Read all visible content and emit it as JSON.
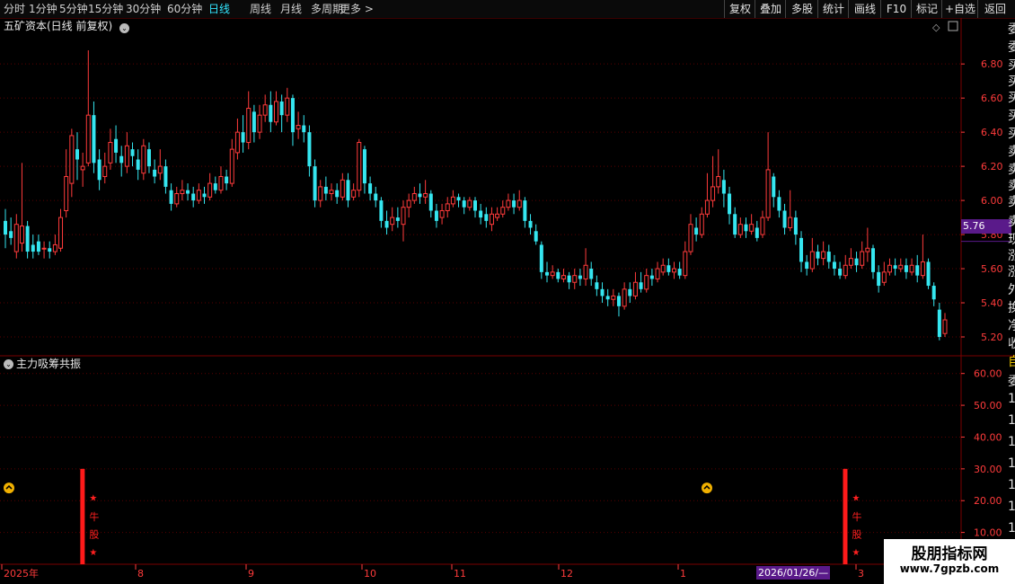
{
  "toolbar": {
    "periods": [
      "分时",
      "1分钟",
      "5分钟",
      "15分钟",
      "30分钟",
      "60分钟",
      "日线",
      "周线",
      "月线",
      "多周期",
      "更多 >"
    ],
    "active": "日线",
    "right": [
      "复权",
      "叠加",
      "多股",
      "统计",
      "画线",
      "F10",
      "标记",
      "+自选",
      "返回"
    ]
  },
  "main_chart": {
    "title": "五矿资本(日线 前复权)",
    "last_price": "5.76"
  },
  "sub_chart": {
    "title": "主力吸筹共振",
    "signal_text": "牛股"
  },
  "x_axis": {
    "labels": [
      "2025年",
      "8",
      "9",
      "10",
      "11",
      "12",
      "1",
      "3"
    ],
    "highlight": "2026/01/26/—"
  },
  "right_panel_chars": [
    "委",
    "委",
    "买",
    "买",
    "买",
    "买",
    "买",
    "卖",
    "卖",
    "卖",
    "卖",
    "卖",
    "现",
    "涨",
    "涨",
    "外",
    "换",
    "净",
    "收",
    "自",
    "委",
    "1",
    "1",
    "1",
    "1",
    "1",
    "1",
    "1",
    "1",
    "1"
  ],
  "watermark": {
    "line1": "股朋指标网",
    "line2": "www.7gpzb.com"
  },
  "colors": {
    "up": "#ff3b3b",
    "down": "#35e6f0",
    "axis": "#ff3b3b",
    "active_tab": "#33e6ff",
    "tag": "#5a1a8a"
  },
  "chart_data": [
    {
      "type": "candlestick",
      "title": "五矿资本(日线 前复权)",
      "ylim": [
        5.1,
        6.98
      ],
      "y_ticks": [
        6.8,
        6.6,
        6.4,
        6.2,
        6.0,
        5.8,
        5.6,
        5.4,
        5.2
      ],
      "y_tick_labels": [
        "6.80",
        "6.60",
        "6.40",
        "6.20",
        "6.00",
        "5.80",
        "5.60",
        "5.40",
        "5.20"
      ],
      "last_price": 5.76,
      "candles": [
        [
          5.88,
          5.8,
          5.95,
          5.72
        ],
        [
          5.82,
          5.78,
          5.9,
          5.74
        ],
        [
          5.7,
          5.86,
          5.92,
          5.66
        ],
        [
          5.75,
          5.85,
          6.22,
          5.7
        ],
        [
          5.85,
          5.7,
          5.88,
          5.66
        ],
        [
          5.74,
          5.7,
          5.8,
          5.66
        ],
        [
          5.76,
          5.7,
          5.8,
          5.68
        ],
        [
          5.72,
          5.72,
          5.76,
          5.66
        ],
        [
          5.72,
          5.7,
          5.76,
          5.66
        ],
        [
          5.7,
          5.74,
          5.8,
          5.68
        ],
        [
          5.72,
          5.9,
          5.95,
          5.7
        ],
        [
          5.94,
          6.14,
          6.3,
          5.9
        ],
        [
          6.1,
          6.38,
          6.42,
          6.02
        ],
        [
          6.3,
          6.24,
          6.4,
          6.12
        ],
        [
          6.18,
          6.2,
          6.28,
          6.08
        ],
        [
          6.22,
          6.5,
          6.88,
          6.2
        ],
        [
          6.5,
          6.22,
          6.58,
          6.16
        ],
        [
          6.24,
          6.12,
          6.3,
          6.06
        ],
        [
          6.14,
          6.2,
          6.28,
          6.1
        ],
        [
          6.22,
          6.34,
          6.42,
          6.18
        ],
        [
          6.36,
          6.28,
          6.44,
          6.22
        ],
        [
          6.26,
          6.22,
          6.32,
          6.14
        ],
        [
          6.2,
          6.32,
          6.4,
          6.16
        ],
        [
          6.3,
          6.26,
          6.34,
          6.2
        ],
        [
          6.24,
          6.18,
          6.3,
          6.12
        ],
        [
          6.16,
          6.32,
          6.36,
          6.12
        ],
        [
          6.3,
          6.2,
          6.34,
          6.16
        ],
        [
          6.18,
          6.14,
          6.24,
          6.1
        ],
        [
          6.16,
          6.2,
          6.3,
          6.12
        ],
        [
          6.2,
          6.08,
          6.24,
          6.04
        ],
        [
          6.06,
          5.98,
          6.1,
          5.94
        ],
        [
          5.98,
          6.04,
          6.08,
          5.96
        ],
        [
          6.04,
          6.06,
          6.12,
          6.0
        ],
        [
          6.06,
          6.04,
          6.1,
          6.0
        ],
        [
          6.04,
          6.0,
          6.08,
          5.96
        ],
        [
          6.0,
          6.06,
          6.1,
          5.98
        ],
        [
          6.04,
          6.02,
          6.08,
          5.98
        ],
        [
          6.02,
          6.1,
          6.16,
          6.0
        ],
        [
          6.1,
          6.06,
          6.14,
          6.04
        ],
        [
          6.06,
          6.14,
          6.2,
          6.04
        ],
        [
          6.14,
          6.1,
          6.18,
          6.06
        ],
        [
          6.1,
          6.3,
          6.36,
          6.08
        ],
        [
          6.28,
          6.4,
          6.48,
          6.24
        ],
        [
          6.4,
          6.34,
          6.5,
          6.28
        ],
        [
          6.34,
          6.54,
          6.64,
          6.3
        ],
        [
          6.52,
          6.4,
          6.56,
          6.34
        ],
        [
          6.4,
          6.5,
          6.56,
          6.36
        ],
        [
          6.5,
          6.56,
          6.62,
          6.46
        ],
        [
          6.56,
          6.46,
          6.64,
          6.4
        ],
        [
          6.46,
          6.58,
          6.64,
          6.44
        ],
        [
          6.58,
          6.5,
          6.62,
          6.4
        ],
        [
          6.5,
          6.6,
          6.66,
          6.46
        ],
        [
          6.6,
          6.4,
          6.62,
          6.32
        ],
        [
          6.42,
          6.44,
          6.52,
          6.36
        ],
        [
          6.44,
          6.4,
          6.5,
          6.34
        ],
        [
          6.4,
          6.2,
          6.44,
          6.14
        ],
        [
          6.2,
          6.0,
          6.24,
          5.96
        ],
        [
          6.0,
          6.08,
          6.12,
          5.96
        ],
        [
          6.08,
          6.04,
          6.14,
          6.0
        ],
        [
          6.04,
          6.06,
          6.1,
          6.0
        ],
        [
          6.06,
          6.02,
          6.1,
          5.98
        ],
        [
          6.02,
          6.12,
          6.16,
          6.0
        ],
        [
          6.12,
          6.0,
          6.16,
          5.96
        ],
        [
          6.02,
          6.06,
          6.1,
          6.0
        ],
        [
          6.06,
          6.34,
          6.36,
          6.02
        ],
        [
          6.3,
          6.1,
          6.32,
          6.04
        ],
        [
          6.1,
          6.04,
          6.14,
          6.0
        ],
        [
          6.04,
          6.0,
          6.08,
          5.96
        ],
        [
          6.0,
          5.88,
          6.02,
          5.84
        ],
        [
          5.88,
          5.84,
          5.94,
          5.8
        ],
        [
          5.86,
          5.9,
          5.96,
          5.82
        ],
        [
          5.9,
          5.88,
          5.96,
          5.84
        ],
        [
          5.86,
          5.96,
          6.0,
          5.76
        ],
        [
          5.96,
          6.0,
          6.04,
          5.9
        ],
        [
          6.0,
          6.04,
          6.08,
          5.98
        ],
        [
          6.04,
          6.02,
          6.1,
          5.98
        ],
        [
          6.02,
          6.04,
          6.12,
          5.98
        ],
        [
          6.04,
          5.94,
          6.06,
          5.9
        ],
        [
          5.94,
          5.88,
          5.98,
          5.84
        ],
        [
          5.9,
          5.94,
          5.98,
          5.86
        ],
        [
          5.94,
          5.98,
          6.02,
          5.9
        ],
        [
          5.98,
          6.02,
          6.06,
          5.96
        ],
        [
          6.02,
          6.0,
          6.04,
          5.96
        ],
        [
          6.0,
          5.96,
          6.02,
          5.92
        ],
        [
          5.96,
          6.0,
          6.02,
          5.94
        ],
        [
          6.0,
          5.94,
          6.02,
          5.9
        ],
        [
          5.94,
          5.9,
          5.98,
          5.86
        ],
        [
          5.92,
          5.88,
          5.96,
          5.84
        ],
        [
          5.86,
          5.92,
          5.96,
          5.82
        ],
        [
          5.9,
          5.92,
          5.96,
          5.88
        ],
        [
          5.92,
          5.96,
          6.0,
          5.9
        ],
        [
          5.96,
          6.0,
          6.04,
          5.94
        ],
        [
          6.0,
          5.96,
          6.04,
          5.92
        ],
        [
          5.96,
          6.0,
          6.06,
          5.94
        ],
        [
          6.0,
          5.88,
          6.02,
          5.84
        ],
        [
          5.88,
          5.84,
          5.92,
          5.8
        ],
        [
          5.82,
          5.76,
          5.86,
          5.74
        ],
        [
          5.74,
          5.58,
          5.76,
          5.54
        ],
        [
          5.58,
          5.56,
          5.64,
          5.52
        ],
        [
          5.56,
          5.58,
          5.62,
          5.54
        ],
        [
          5.58,
          5.54,
          5.6,
          5.52
        ],
        [
          5.54,
          5.56,
          5.6,
          5.52
        ],
        [
          5.56,
          5.52,
          5.58,
          5.48
        ],
        [
          5.52,
          5.56,
          5.6,
          5.48
        ],
        [
          5.56,
          5.54,
          5.6,
          5.5
        ],
        [
          5.54,
          5.62,
          5.72,
          5.5
        ],
        [
          5.6,
          5.54,
          5.64,
          5.5
        ],
        [
          5.52,
          5.48,
          5.56,
          5.44
        ],
        [
          5.48,
          5.44,
          5.52,
          5.4
        ],
        [
          5.44,
          5.42,
          5.48,
          5.38
        ],
        [
          5.42,
          5.44,
          5.48,
          5.38
        ],
        [
          5.44,
          5.38,
          5.46,
          5.32
        ],
        [
          5.38,
          5.48,
          5.52,
          5.36
        ],
        [
          5.48,
          5.44,
          5.52,
          5.4
        ],
        [
          5.44,
          5.52,
          5.58,
          5.42
        ],
        [
          5.52,
          5.48,
          5.58,
          5.46
        ],
        [
          5.48,
          5.56,
          5.6,
          5.46
        ],
        [
          5.56,
          5.54,
          5.6,
          5.5
        ],
        [
          5.54,
          5.6,
          5.64,
          5.52
        ],
        [
          5.58,
          5.62,
          5.66,
          5.56
        ],
        [
          5.62,
          5.58,
          5.66,
          5.56
        ],
        [
          5.58,
          5.6,
          5.64,
          5.54
        ],
        [
          5.6,
          5.56,
          5.64,
          5.54
        ],
        [
          5.56,
          5.7,
          5.76,
          5.54
        ],
        [
          5.7,
          5.86,
          5.92,
          5.68
        ],
        [
          5.84,
          5.8,
          5.9,
          5.76
        ],
        [
          5.8,
          5.92,
          5.96,
          5.78
        ],
        [
          5.92,
          6.0,
          6.16,
          5.9
        ],
        [
          6.0,
          6.08,
          6.26,
          5.96
        ],
        [
          6.08,
          6.14,
          6.3,
          6.04
        ],
        [
          6.12,
          6.04,
          6.18,
          5.96
        ],
        [
          6.04,
          5.92,
          6.08,
          5.86
        ],
        [
          5.92,
          5.8,
          5.96,
          5.78
        ],
        [
          5.8,
          5.86,
          5.9,
          5.78
        ],
        [
          5.86,
          5.82,
          5.9,
          5.78
        ],
        [
          5.82,
          5.86,
          5.92,
          5.8
        ],
        [
          5.84,
          5.78,
          5.88,
          5.76
        ],
        [
          5.8,
          5.9,
          5.94,
          5.78
        ],
        [
          5.9,
          6.18,
          6.4,
          5.88
        ],
        [
          6.14,
          6.02,
          6.16,
          5.96
        ],
        [
          6.02,
          5.94,
          6.06,
          5.9
        ],
        [
          5.94,
          5.84,
          5.98,
          5.8
        ],
        [
          5.84,
          5.9,
          6.06,
          5.82
        ],
        [
          5.9,
          5.8,
          5.94,
          5.74
        ],
        [
          5.78,
          5.64,
          5.82,
          5.58
        ],
        [
          5.64,
          5.6,
          5.68,
          5.56
        ],
        [
          5.6,
          5.7,
          5.78,
          5.58
        ],
        [
          5.7,
          5.66,
          5.74,
          5.62
        ],
        [
          5.66,
          5.7,
          5.76,
          5.62
        ],
        [
          5.7,
          5.64,
          5.74,
          5.6
        ],
        [
          5.64,
          5.6,
          5.68,
          5.56
        ],
        [
          5.6,
          5.56,
          5.64,
          5.54
        ],
        [
          5.56,
          5.62,
          5.68,
          5.54
        ],
        [
          5.62,
          5.66,
          5.72,
          5.6
        ],
        [
          5.66,
          5.62,
          5.7,
          5.58
        ],
        [
          5.62,
          5.7,
          5.76,
          5.6
        ],
        [
          5.7,
          5.72,
          5.84,
          5.64
        ],
        [
          5.72,
          5.58,
          5.74,
          5.54
        ],
        [
          5.58,
          5.5,
          5.62,
          5.46
        ],
        [
          5.52,
          5.58,
          5.64,
          5.5
        ],
        [
          5.58,
          5.62,
          5.66,
          5.56
        ],
        [
          5.62,
          5.6,
          5.66,
          5.56
        ],
        [
          5.6,
          5.62,
          5.66,
          5.58
        ],
        [
          5.62,
          5.58,
          5.66,
          5.54
        ],
        [
          5.58,
          5.62,
          5.66,
          5.56
        ],
        [
          5.62,
          5.56,
          5.68,
          5.52
        ],
        [
          5.56,
          5.64,
          5.8,
          5.54
        ],
        [
          5.64,
          5.5,
          5.66,
          5.48
        ],
        [
          5.5,
          5.42,
          5.52,
          5.38
        ],
        [
          5.36,
          5.2,
          5.4,
          5.18
        ],
        [
          5.22,
          5.3,
          5.34,
          5.2
        ]
      ]
    },
    {
      "type": "bar",
      "title": "主力吸筹共振",
      "ylim": [
        0,
        65
      ],
      "y_ticks": [
        60,
        50,
        40,
        30,
        20,
        10
      ],
      "y_tick_labels": [
        "60.00",
        "50.00",
        "40.00",
        "30.00",
        "20.00",
        "10.00"
      ],
      "signal_bars": [
        {
          "index": 9,
          "value": 30
        },
        {
          "index": 147,
          "value": 30
        }
      ]
    }
  ]
}
